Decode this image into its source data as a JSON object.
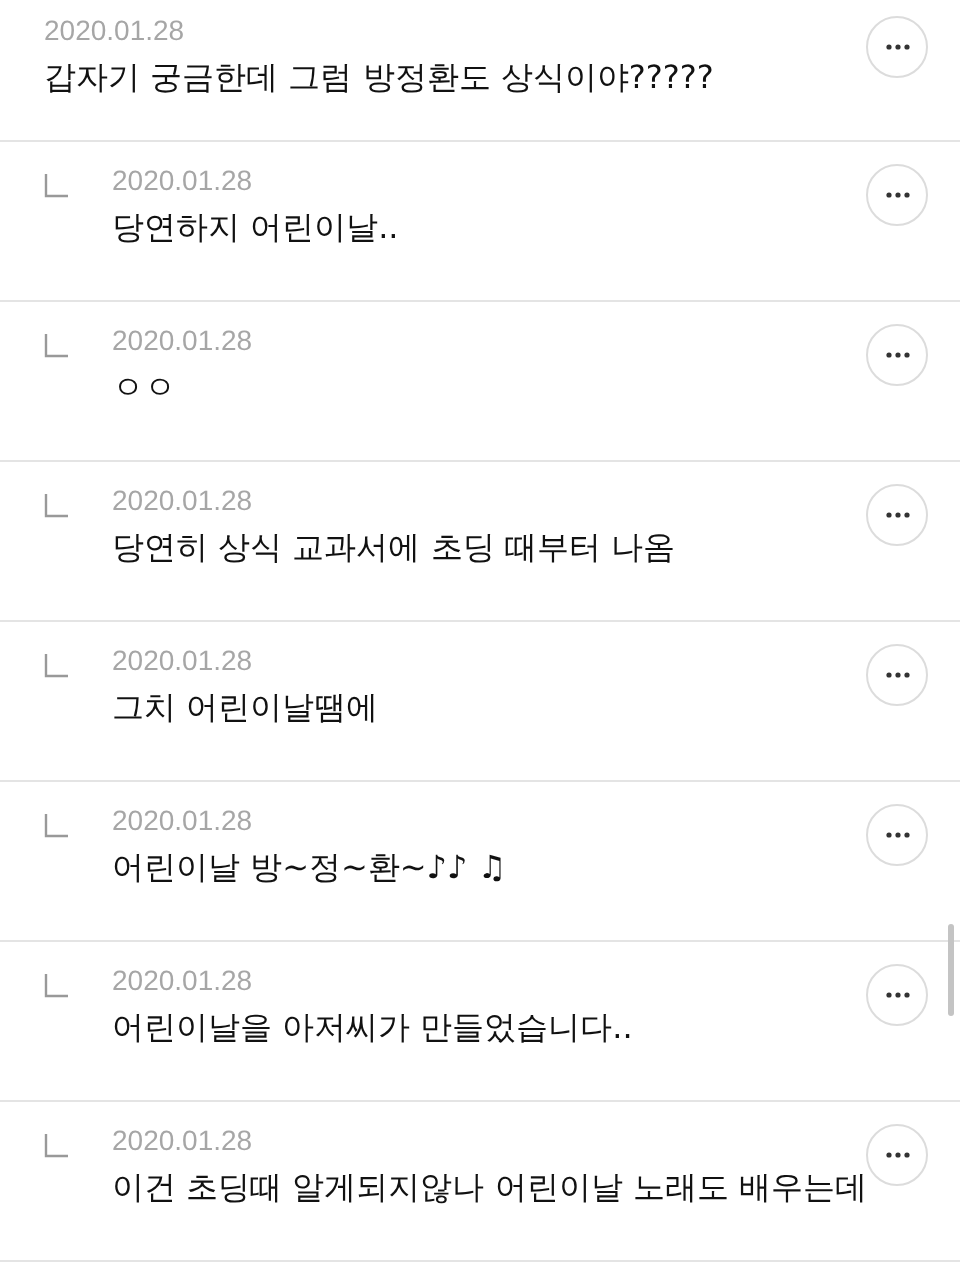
{
  "comments": [
    {
      "kind": "comment",
      "date": "2020.01.28",
      "text": "갑자기 궁금한데 그럼 방정환도 상식이야?????"
    },
    {
      "kind": "reply",
      "date": "2020.01.28",
      "text": "당연하지 어린이날.."
    },
    {
      "kind": "reply",
      "date": "2020.01.28",
      "text": "ㅇㅇ"
    },
    {
      "kind": "reply",
      "date": "2020.01.28",
      "text": "당연히 상식 교과서에 초딩 때부터 나옴"
    },
    {
      "kind": "reply",
      "date": "2020.01.28",
      "text": "그치 어린이날땜에"
    },
    {
      "kind": "reply",
      "date": "2020.01.28",
      "text": "어린이날 방~정~환~♪♪ ♫"
    },
    {
      "kind": "reply",
      "date": "2020.01.28",
      "text": "어린이날을 아저씨가 만들었습니다.."
    },
    {
      "kind": "reply",
      "date": "2020.01.28",
      "text": "이건 초딩때 알게되지않나 어린이날 노래도 배우는데"
    }
  ]
}
